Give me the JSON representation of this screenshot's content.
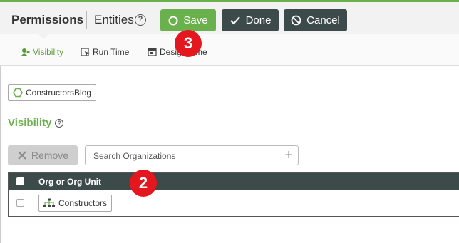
{
  "header": {
    "title": "Permissions",
    "entities_label": "Entities",
    "help_glyph": "?",
    "save_label": "Save",
    "done_label": "Done",
    "cancel_label": "Cancel"
  },
  "tabs": [
    {
      "label": "Visibility",
      "icon": "eye-person-icon",
      "active": true
    },
    {
      "label": "Run Time",
      "icon": "run-time-icon",
      "active": false
    },
    {
      "label": "Design Time",
      "icon": "design-time-icon",
      "active": false
    }
  ],
  "annotations": {
    "badge_1": "3",
    "badge_2": "2"
  },
  "entity": {
    "name": "ConstructorsBlog",
    "icon": "hexagon-icon"
  },
  "visibility": {
    "title": "Visibility",
    "help_glyph": "?",
    "remove_label": "Remove",
    "search_placeholder": "Search Organizations",
    "plus_glyph": "+"
  },
  "table": {
    "column_header": "Org or Org Unit",
    "rows": [
      {
        "name": "Constructors",
        "icon": "org-tree-icon"
      }
    ]
  },
  "colors": {
    "accent": "#6ab04c",
    "dark_button": "#3d4a4a",
    "badge": "#e4171e"
  }
}
